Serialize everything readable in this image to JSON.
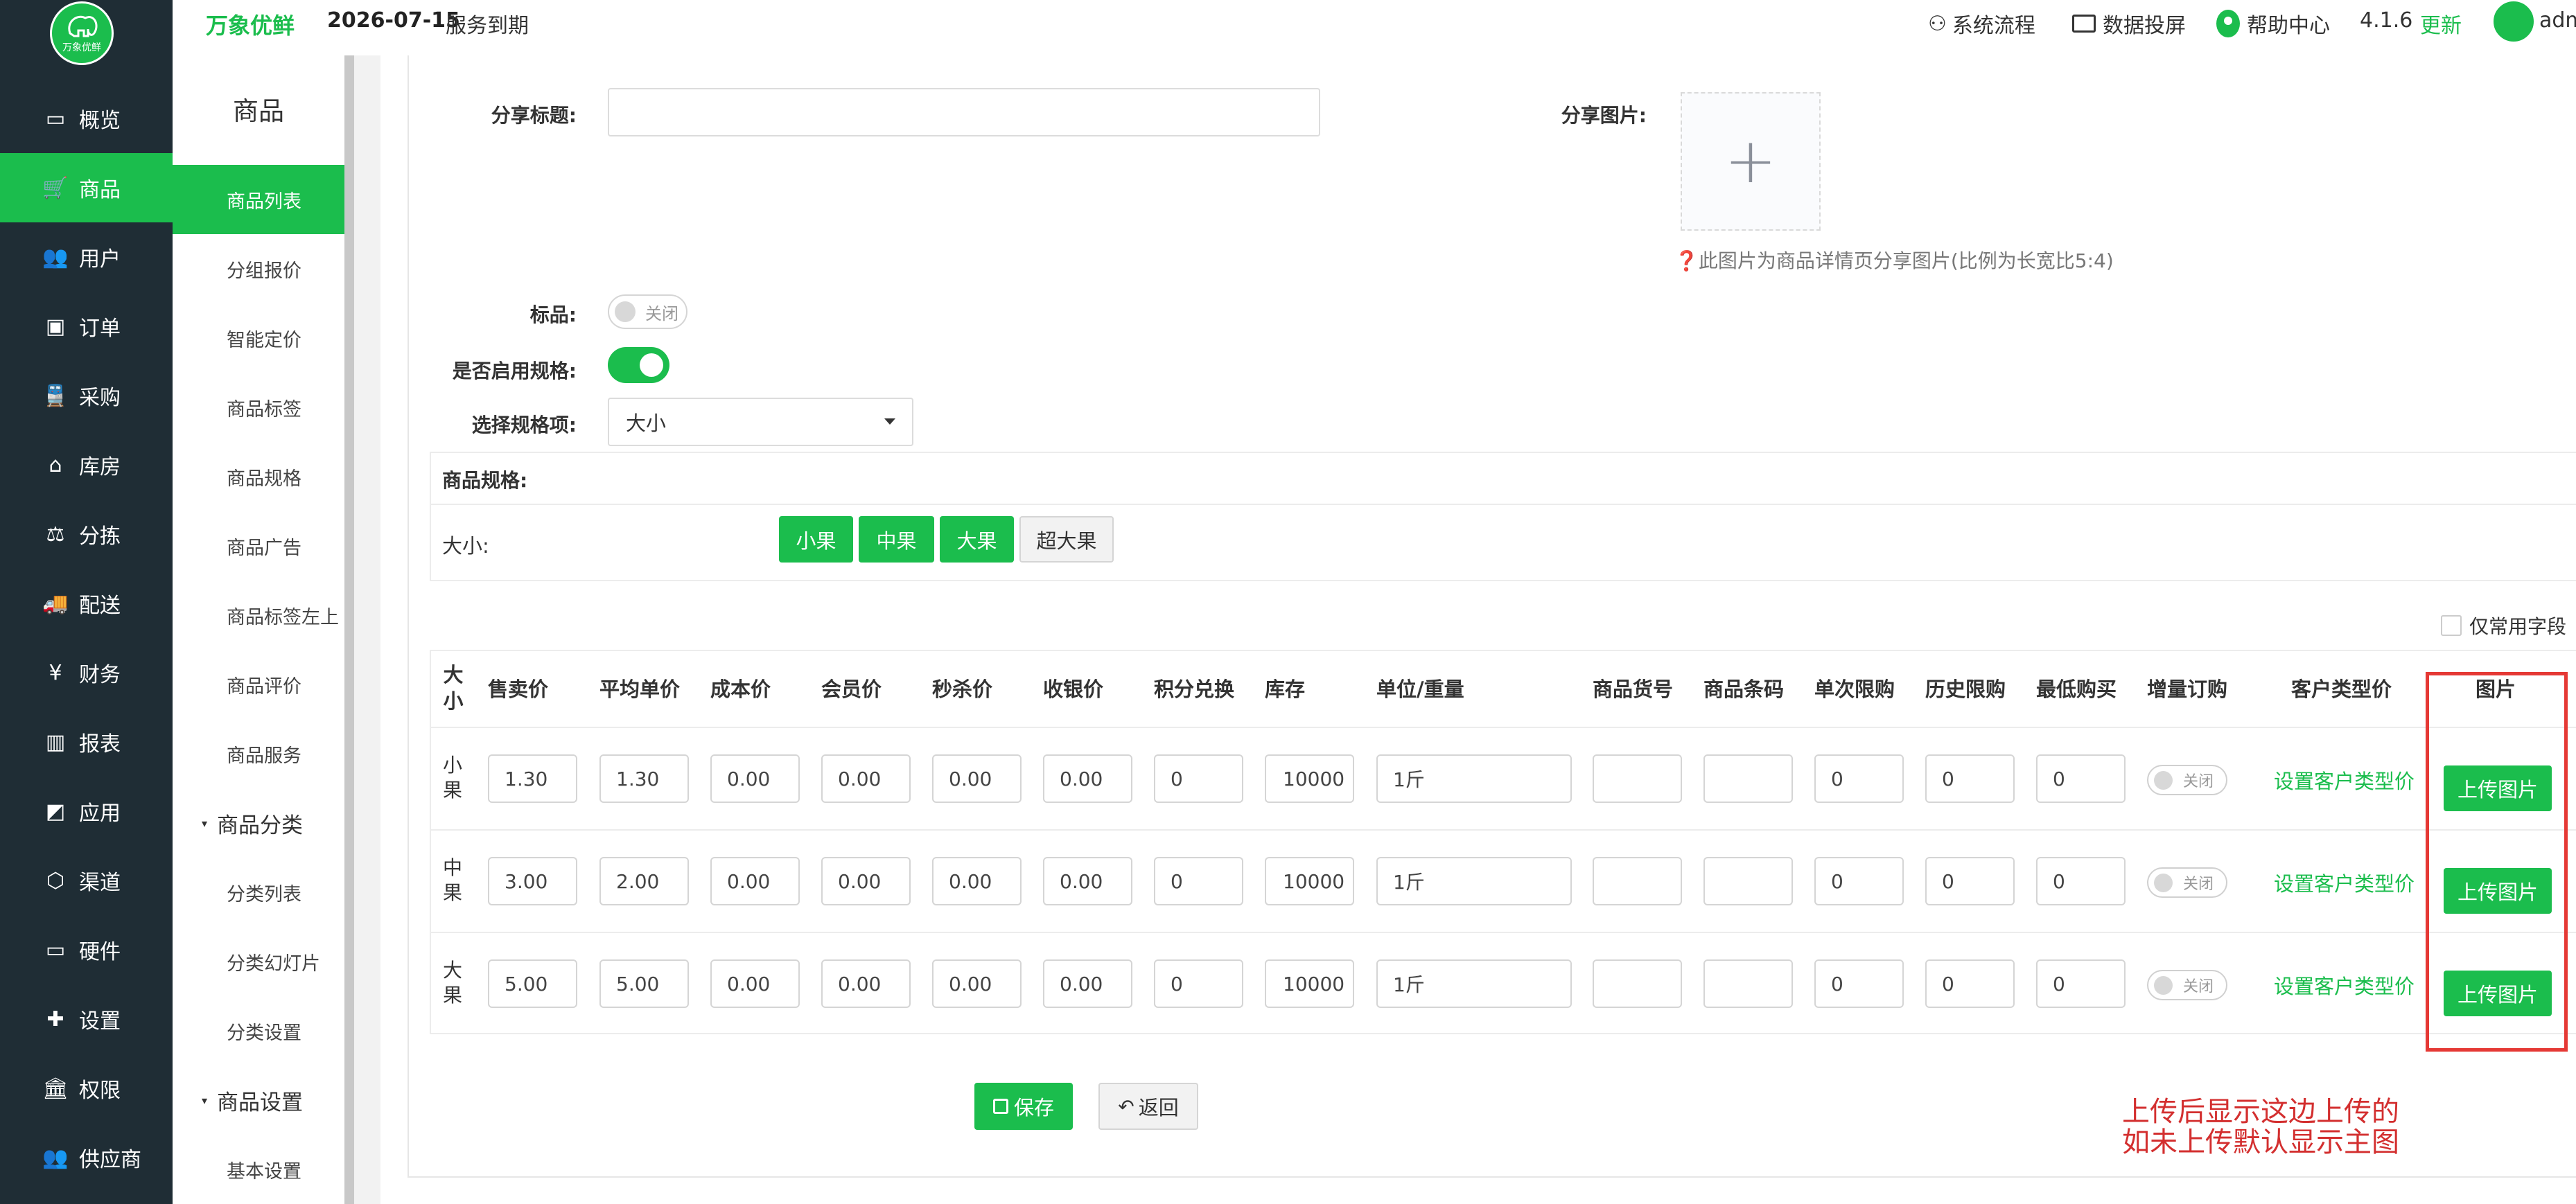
{
  "brand": {
    "name": "万象优鲜",
    "logo_text": "万象优鲜",
    "expiry_date": "2026-07-15",
    "expiry_text": "服务到期"
  },
  "header": {
    "process": "系统流程",
    "screen": "数据投屏",
    "help": "帮助中心",
    "version": "4.1.6",
    "update": "更新",
    "user": "adm"
  },
  "leftnav": [
    {
      "label": "概览",
      "icon": "monitor-icon"
    },
    {
      "label": "商品",
      "icon": "cart-icon",
      "active": true
    },
    {
      "label": "用户",
      "icon": "users-icon"
    },
    {
      "label": "订单",
      "icon": "money-icon"
    },
    {
      "label": "采购",
      "icon": "train-icon"
    },
    {
      "label": "库房",
      "icon": "home-icon"
    },
    {
      "label": "分拣",
      "icon": "scale-icon"
    },
    {
      "label": "配送",
      "icon": "truck-icon"
    },
    {
      "label": "财务",
      "icon": "yen-icon"
    },
    {
      "label": "报表",
      "icon": "bar-chart-icon"
    },
    {
      "label": "应用",
      "icon": "apps-icon"
    },
    {
      "label": "渠道",
      "icon": "cube-icon"
    },
    {
      "label": "硬件",
      "icon": "desktop-icon"
    },
    {
      "label": "设置",
      "icon": "puzzle-icon"
    },
    {
      "label": "权限",
      "icon": "bank-icon"
    },
    {
      "label": "供应商",
      "icon": "users-icon"
    }
  ],
  "subnav": {
    "title": "商品",
    "items": [
      "商品列表",
      "分组报价",
      "智能定价",
      "商品标签",
      "商品规格",
      "商品广告",
      "商品标签左上",
      "商品评价",
      "商品服务"
    ],
    "group1": "商品分类",
    "group1_items": [
      "分类列表",
      "分类幻灯片",
      "分类设置"
    ],
    "group2": "商品设置",
    "group2_items": [
      "基本设置"
    ]
  },
  "form": {
    "share_title_label": "分享标题:",
    "share_title_value": "",
    "share_image_label": "分享图片:",
    "share_image_hint": "❓此图片为商品详情页分享图片(比例为长宽比5:4)",
    "tag_label": "标品:",
    "tag_toggle": "关闭",
    "spec_enable_label": "是否启用规格:",
    "spec_select_label": "选择规格项:",
    "spec_select_value": "大小",
    "spec_box_title": "商品规格:",
    "spec_row_label": "大小:",
    "spec_options": [
      {
        "label": "小果",
        "selected": true
      },
      {
        "label": "中果",
        "selected": true
      },
      {
        "label": "大果",
        "selected": true
      },
      {
        "label": "超大果",
        "selected": false
      }
    ],
    "common_fields_label": "仅常用字段"
  },
  "table": {
    "headers": [
      "大小",
      "售卖价",
      "平均单价",
      "成本价",
      "会员价",
      "秒杀价",
      "收银价",
      "积分兑换",
      "库存",
      "单位/重量",
      "商品货号",
      "商品条码",
      "单次限购",
      "历史限购",
      "最低购买",
      "增量订购",
      "客户类型价",
      "图片"
    ],
    "rows": [
      {
        "label": "小果",
        "price": "1.30",
        "avg": "1.30",
        "cost": "0.00",
        "member": "0.00",
        "seckill": "0.00",
        "cashier": "0.00",
        "points": "0",
        "stock": "10000",
        "unit": "1斤",
        "sku": "",
        "barcode": "",
        "limit_once": "0",
        "limit_hist": "0",
        "min_buy": "0",
        "incr": "关闭",
        "cust_price": "设置客户类型价",
        "upload": "上传图片"
      },
      {
        "label": "中果",
        "price": "3.00",
        "avg": "2.00",
        "cost": "0.00",
        "member": "0.00",
        "seckill": "0.00",
        "cashier": "0.00",
        "points": "0",
        "stock": "10000",
        "unit": "1斤",
        "sku": "",
        "barcode": "",
        "limit_once": "0",
        "limit_hist": "0",
        "min_buy": "0",
        "incr": "关闭",
        "cust_price": "设置客户类型价",
        "upload": "上传图片"
      },
      {
        "label": "大果",
        "price": "5.00",
        "avg": "5.00",
        "cost": "0.00",
        "member": "0.00",
        "seckill": "0.00",
        "cashier": "0.00",
        "points": "0",
        "stock": "10000",
        "unit": "1斤",
        "sku": "",
        "barcode": "",
        "limit_once": "0",
        "limit_hist": "0",
        "min_buy": "0",
        "incr": "关闭",
        "cust_price": "设置客户类型价",
        "upload": "上传图片"
      }
    ]
  },
  "actions": {
    "save": "保存",
    "back": "返回"
  },
  "annotation": {
    "line1": "上传后显示这边上传的",
    "line2": "如未上传默认显示主图",
    "color": "#d32f2f"
  },
  "colors": {
    "accent": "#1bbd4d",
    "nav_bg": "#1f2d35",
    "highlight": "#e53935"
  }
}
